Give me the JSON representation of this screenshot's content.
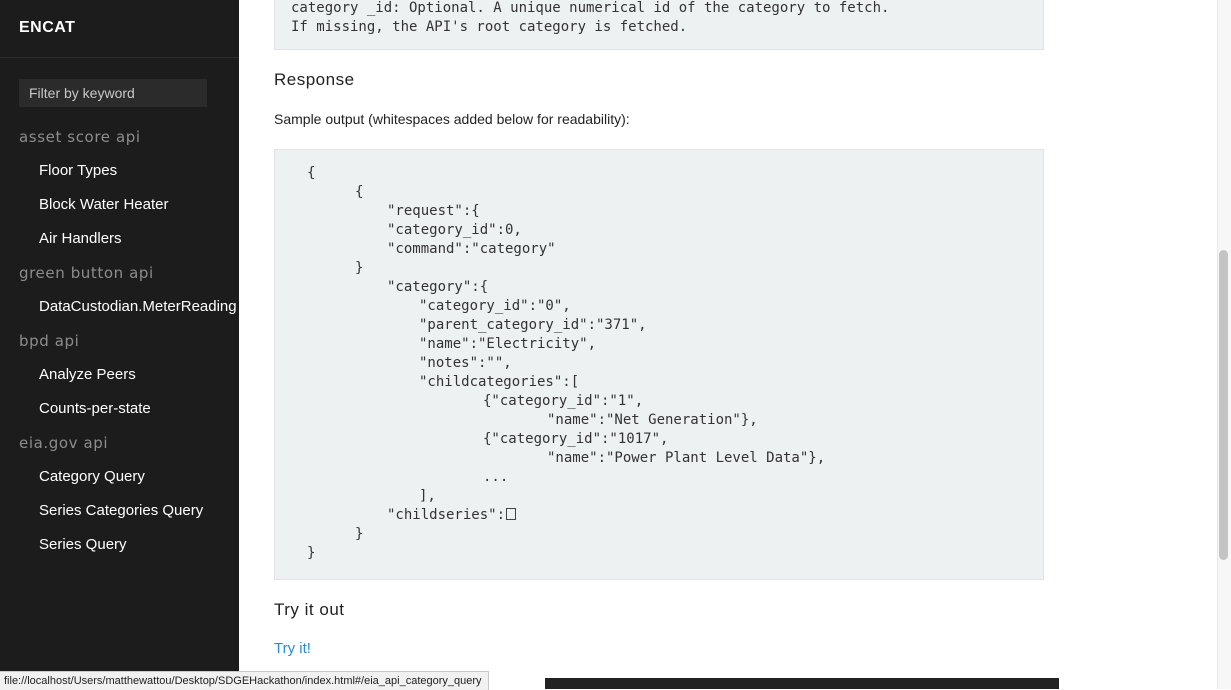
{
  "sidebar": {
    "brand": "ENCAT",
    "filter_placeholder": "Filter by keyword",
    "groups": [
      {
        "label": "asset score api",
        "items": [
          "Floor Types",
          "Block Water Heater",
          "Air Handlers"
        ]
      },
      {
        "label": "green button api",
        "items": [
          "DataCustodian.MeterReading"
        ]
      },
      {
        "label": "bpd api",
        "items": [
          "Analyze Peers",
          "Counts-per-state"
        ]
      },
      {
        "label": "eia.gov api",
        "items": [
          "Category Query",
          "Series Categories Query",
          "Series Query"
        ]
      }
    ]
  },
  "main": {
    "param_lines": [
      "category _id: Optional. A unique numerical id of the category to fetch.",
      "If missing, the API's root category is fetched."
    ],
    "response_heading": "Response",
    "sample_text": "Sample output (whitespaces added below for readability):",
    "code_lines": [
      "{",
      "{",
      "\"request\":{",
      "\"category_id\":0,",
      "\"command\":\"category\"",
      "}",
      "\"category\":{",
      "\"category_id\":\"0\",",
      "\"parent_category_id\":\"371\",",
      "\"name\":\"Electricity\",",
      "\"notes\":\"\",",
      "\"childcategories\":[",
      "{\"category_id\":\"1\",",
      "\"name\":\"Net Generation\"},",
      "{\"category_id\":\"1017\",",
      "\"name\":\"Power Plant Level Data\"},",
      "...",
      "],",
      "\"childseries\":",
      "}",
      "}"
    ],
    "try_heading": "Try it out",
    "try_link": "Try it!"
  },
  "status": {
    "url": "file://localhost/Users/matthewattou/Desktop/SDGEHackathon/index.html#/eia_api_category_query"
  }
}
